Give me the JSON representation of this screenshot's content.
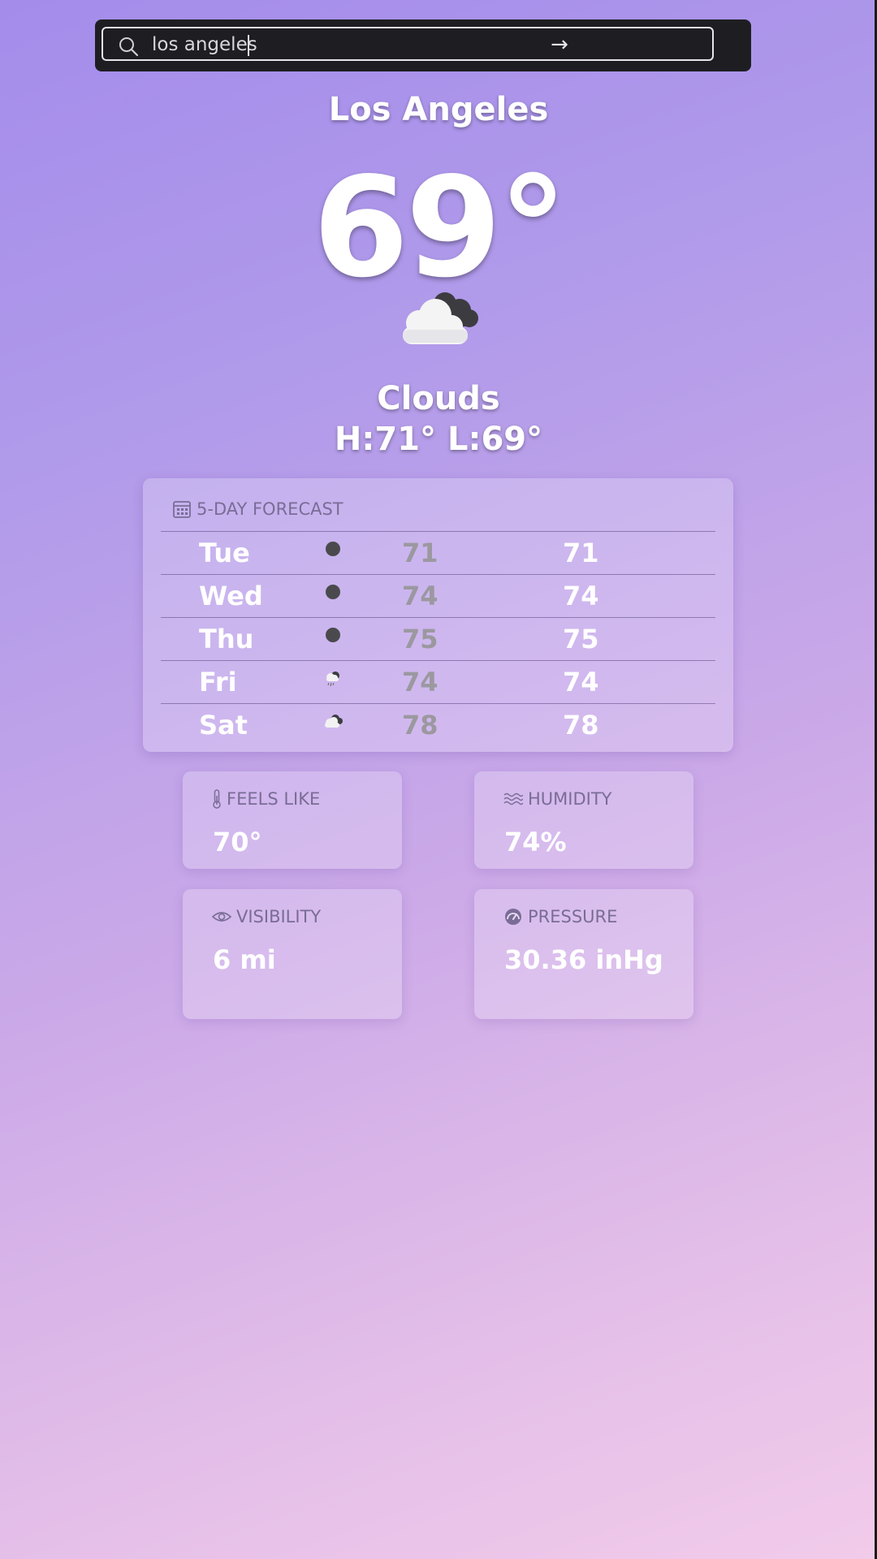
{
  "search": {
    "value": "los angeles",
    "submit_label": "→"
  },
  "current": {
    "city": "Los Angeles",
    "temperature": "69°",
    "condition": "Clouds",
    "high_low": "H:71° L:69°",
    "icon": "clouds-icon"
  },
  "forecast": {
    "title": "5-DAY FORECAST",
    "days": [
      {
        "day": "Tue",
        "icon": "dark-circle-icon",
        "low": "71",
        "high": "71"
      },
      {
        "day": "Wed",
        "icon": "dark-circle-icon",
        "low": "74",
        "high": "74"
      },
      {
        "day": "Thu",
        "icon": "dark-circle-icon",
        "low": "75",
        "high": "75"
      },
      {
        "day": "Fri",
        "icon": "rain-cloud-icon",
        "low": "74",
        "high": "74"
      },
      {
        "day": "Sat",
        "icon": "clouds-icon",
        "low": "78",
        "high": "78"
      }
    ]
  },
  "details": {
    "feels_like": {
      "label": "FEELS LIKE",
      "value": "70°"
    },
    "humidity": {
      "label": "HUMIDITY",
      "value": "74%"
    },
    "visibility": {
      "label": "VISIBILITY",
      "value": "6 mi"
    },
    "pressure": {
      "label": "PRESSURE",
      "value": "30.36 inHg"
    }
  },
  "colors": {
    "gradient_start": "#a48ceb",
    "gradient_end": "#f2cbea",
    "search_bg": "#1e1e22",
    "muted_label": "#7a6c96",
    "low_temp": "#9b98a0"
  }
}
